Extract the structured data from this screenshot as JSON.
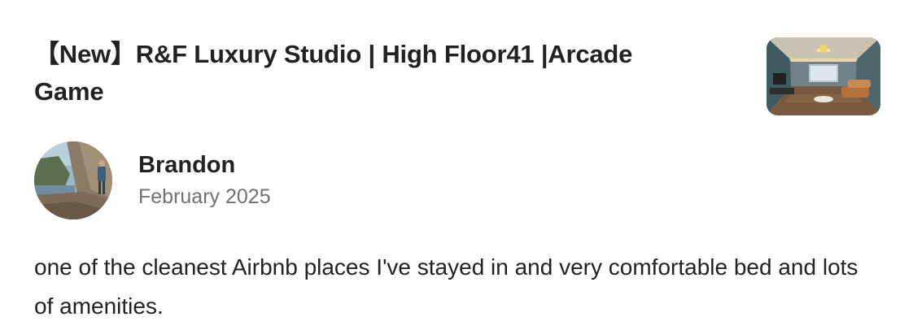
{
  "listing": {
    "title": "【New】R&F Luxury Studio | High Floor41 |Arcade Game",
    "thumbnail_icon": "listing-photo-thumbnail"
  },
  "review": {
    "reviewer_name": "Brandon",
    "date": "February 2025",
    "text": "one of the cleanest Airbnb places I've stayed in and very comfortable bed and lots of amenities.",
    "avatar_icon": "reviewer-avatar-photo"
  }
}
